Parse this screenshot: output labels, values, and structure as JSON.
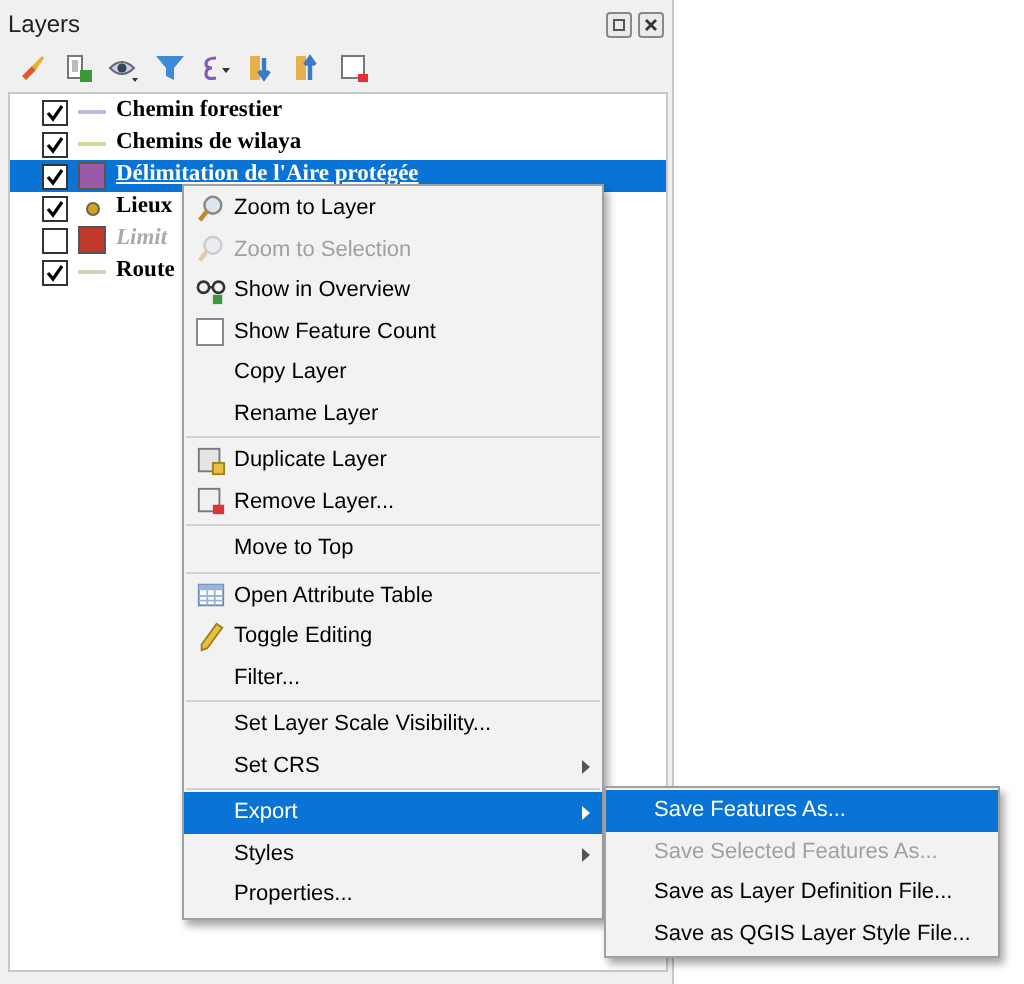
{
  "panel": {
    "title": "Layers"
  },
  "toolbar": [
    {
      "kind": "brush"
    },
    {
      "kind": "add"
    },
    {
      "kind": "eye"
    },
    {
      "kind": "filter"
    },
    {
      "kind": "epsilon"
    },
    {
      "kind": "expand"
    },
    {
      "kind": "collapse"
    },
    {
      "kind": "remove"
    }
  ],
  "layers": [
    {
      "name": "Chemin forestier",
      "checked": true,
      "kind": "line",
      "color": "#c9b6e4",
      "selected": false
    },
    {
      "name": "Chemins de wilaya",
      "checked": true,
      "kind": "line",
      "color": "#c8dc9c",
      "selected": false
    },
    {
      "name": "Délimitation de l'Aire protégée",
      "checked": true,
      "kind": "fill",
      "color": "#9b5aa6",
      "selected": true
    },
    {
      "name": "Lieux",
      "checked": true,
      "kind": "point",
      "color": "#d6a21e",
      "selected": false
    },
    {
      "name": "Limit",
      "checked": false,
      "kind": "fill",
      "color": "#c0392b",
      "selected": false
    },
    {
      "name": "Route",
      "checked": true,
      "kind": "line",
      "color": "#d9d2ba",
      "selected": false
    }
  ],
  "context_menu": {
    "items": [
      {
        "label": "Zoom to Layer",
        "kind": "zoom",
        "disabled": false,
        "selected": false
      },
      {
        "label": "Zoom to Selection",
        "kind": "zoom",
        "disabled": true,
        "selected": false
      },
      {
        "label": "Show in Overview",
        "kind": "overview",
        "disabled": false,
        "selected": false
      },
      {
        "label": "Show Feature Count",
        "kind": "checkbox",
        "checked": false,
        "disabled": false,
        "selected": false
      },
      {
        "label": "Copy Layer",
        "disabled": false,
        "selected": false
      },
      {
        "label": "Rename Layer",
        "disabled": false,
        "selected": false,
        "separator_after": true
      },
      {
        "label": "Duplicate Layer",
        "kind": "duplicate",
        "disabled": false,
        "selected": false
      },
      {
        "label": "Remove Layer...",
        "kind": "remove",
        "disabled": false,
        "selected": false,
        "separator_after": true
      },
      {
        "label": "Move to Top",
        "disabled": false,
        "selected": false,
        "separator_after": true
      },
      {
        "label": "Open Attribute Table",
        "kind": "table",
        "disabled": false,
        "selected": false
      },
      {
        "label": "Toggle Editing",
        "kind": "pencil",
        "disabled": false,
        "selected": false
      },
      {
        "label": "Filter...",
        "disabled": false,
        "selected": false,
        "separator_after": true
      },
      {
        "label": "Set Layer Scale Visibility...",
        "disabled": false,
        "selected": false
      },
      {
        "label": "Set CRS",
        "submenu": true,
        "disabled": false,
        "selected": false,
        "separator_after": true
      },
      {
        "label": "Export",
        "submenu": true,
        "disabled": false,
        "selected": true
      },
      {
        "label": "Styles",
        "submenu": true,
        "disabled": false,
        "selected": false
      },
      {
        "label": "Properties...",
        "disabled": false,
        "selected": false
      }
    ]
  },
  "submenu": {
    "items": [
      {
        "label": "Save Features As...",
        "disabled": false,
        "selected": true
      },
      {
        "label": "Save Selected Features As...",
        "disabled": true,
        "selected": false
      },
      {
        "label": "Save as Layer Definition File...",
        "disabled": false,
        "selected": false
      },
      {
        "label": "Save as QGIS Layer Style File...",
        "disabled": false,
        "selected": false
      }
    ]
  }
}
